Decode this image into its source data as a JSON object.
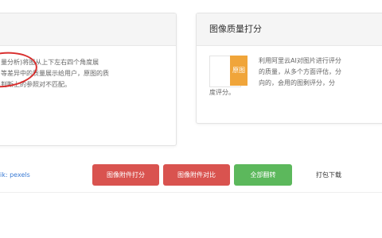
{
  "left_card": {
    "lines": [
      "量分析)将图从上下左右四个角度展",
      "等差异中的质量展示给用户，原图的质",
      "判断上的参照对不匹配。"
    ]
  },
  "right_card": {
    "title": "图像质量打分",
    "tag_label": "原图",
    "lines": [
      "利用阿里云AI对图片进行评分",
      "的质量，从多个方面评估，分",
      "向的，会用的图剩评分，分",
      "度评分。"
    ]
  },
  "actions": {
    "link_text": "ik: pexels",
    "btn_analyze": "图像附件打分",
    "btn_compare": "图像附件对比",
    "btn_all": "全部翻转",
    "btn_download": "打包下载"
  }
}
